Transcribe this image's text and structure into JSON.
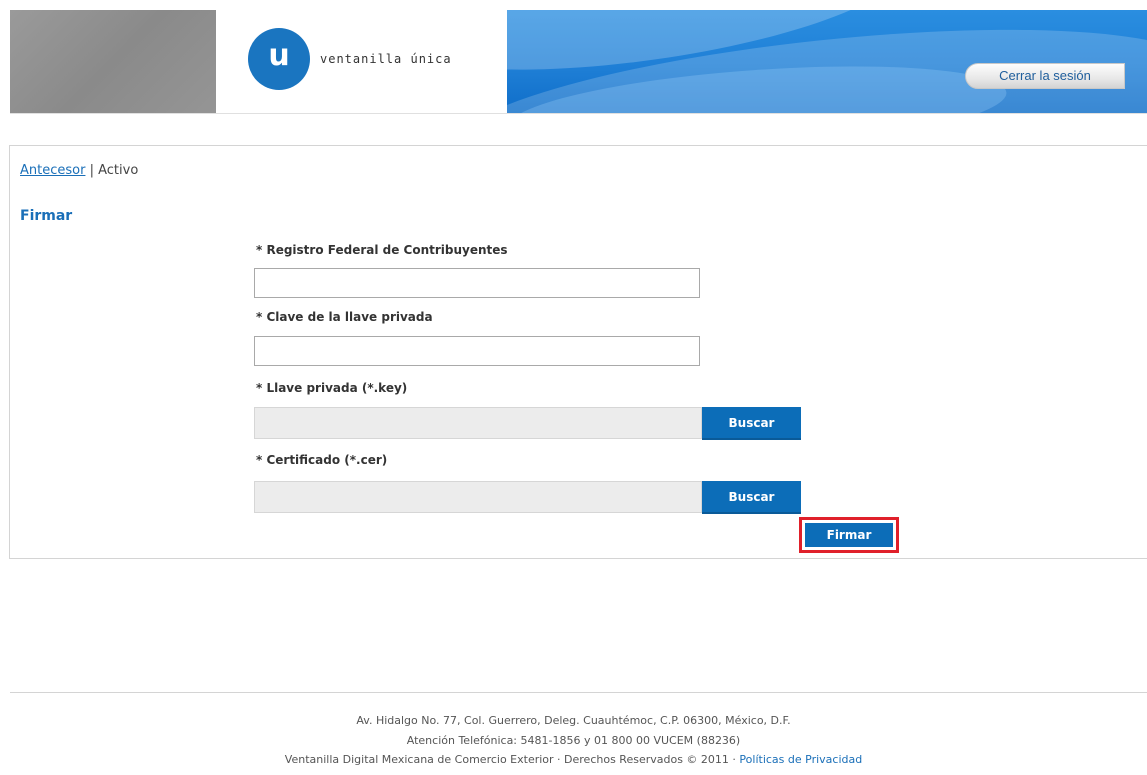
{
  "header": {
    "logo_letter": "u",
    "logo_text": "ventanilla única",
    "logout_label": "Cerrar la sesión"
  },
  "breadcrumb": {
    "previous": "Antecesor",
    "separator": " | ",
    "current": "Activo"
  },
  "form": {
    "title": "Firmar",
    "rfc_label": "* Registro Federal de Contribuyentes",
    "rfc_value": "",
    "password_label": "* Clave de la llave privada",
    "password_value": "",
    "key_label": "* Llave privada (*.key)",
    "key_browse": "Buscar",
    "cert_label": "* Certificado (*.cer)",
    "cert_browse": "Buscar",
    "submit_label": "Firmar"
  },
  "footer": {
    "address": "Av. Hidalgo No. 77, Col. Guerrero, Deleg. Cuauhtémoc, C.P. 06300, México, D.F.",
    "phone": "Atención Telefónica: 5481-1856 y 01 800 00 VUCEM (88236)",
    "rights": "Ventanilla Digital Mexicana de Comercio Exterior · Derechos Reservados © 2011 · ",
    "privacy_link": "Políticas de Privacidad"
  },
  "colors": {
    "brand_blue": "#0c6db8",
    "link_blue": "#1a6fb8",
    "highlight_red": "#e0202a"
  }
}
